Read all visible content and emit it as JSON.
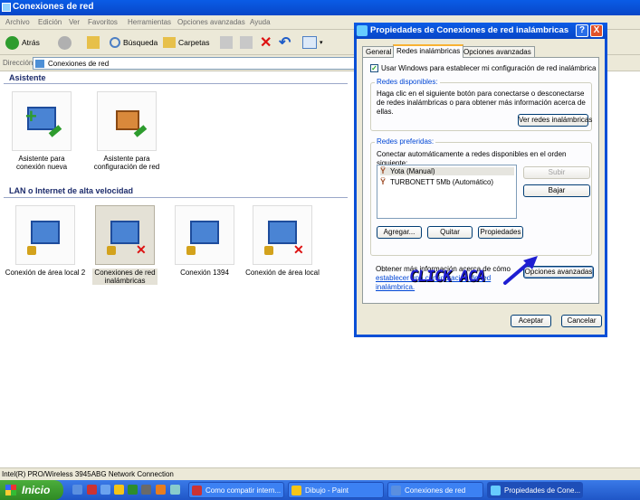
{
  "window": {
    "title": "Conexiones de red"
  },
  "menu": [
    "Archivo",
    "Edición",
    "Ver",
    "Favoritos",
    "Herramientas",
    "Opciones avanzadas",
    "Ayuda"
  ],
  "toolbar": {
    "back": "Atrás",
    "search": "Búsqueda",
    "folders": "Carpetas"
  },
  "address": {
    "label": "Dirección",
    "value": "Conexiones de red"
  },
  "sections": {
    "wizard": {
      "title": "Asistente",
      "items": [
        "Asistente para conexión nueva",
        "Asistente para configuración de red"
      ]
    },
    "lan": {
      "title": "LAN o Internet de alta velocidad",
      "items": [
        "Conexión de área local 2",
        "Conexiones de red inalámbricas",
        "Conexión 1394",
        "Conexión de área local"
      ]
    }
  },
  "statusbar": "Intel(R) PRO/Wireless 3945ABG Network Connection",
  "taskbar": {
    "start": "Inicio",
    "tasks": [
      "Como compatir intern...",
      "Dibujo - Paint",
      "Conexiones de red",
      "Propiedades de Cone..."
    ]
  },
  "dialog": {
    "title": "Propiedades de Conexiones de red inalámbricas",
    "help_btn": "?",
    "close_btn": "X",
    "tabs": [
      "General",
      "Redes inalámbricas",
      "Opciones avanzadas"
    ],
    "use_windows_check": "Usar Windows para establecer mi configuración de red inalámbrica",
    "available": {
      "label": "Redes disponibles:",
      "text": "Haga clic en el siguiente botón para conectarse o desconectarse de redes inalámbricas o para obtener más información acerca de ellas.",
      "view_button": "Ver redes inalámbricas"
    },
    "preferred": {
      "label": "Redes preferidas:",
      "text": "Conectar automáticamente a redes disponibles en el orden siguiente:",
      "networks": [
        "Yota (Manual)",
        "TURBONETT 5Mb (Automático)"
      ],
      "up_button": "Subir",
      "down_button": "Bajar",
      "add_button": "Agregar...",
      "remove_button": "Quitar",
      "properties_button": "Propiedades"
    },
    "info_text": "Obtener más información acerca de cómo",
    "info_link": "establecer una configuración de red inalámbrica.",
    "advanced_button": "Opciones avanzadas",
    "ok_button": "Aceptar",
    "cancel_button": "Cancelar"
  },
  "annotation": "CLICK ACA"
}
